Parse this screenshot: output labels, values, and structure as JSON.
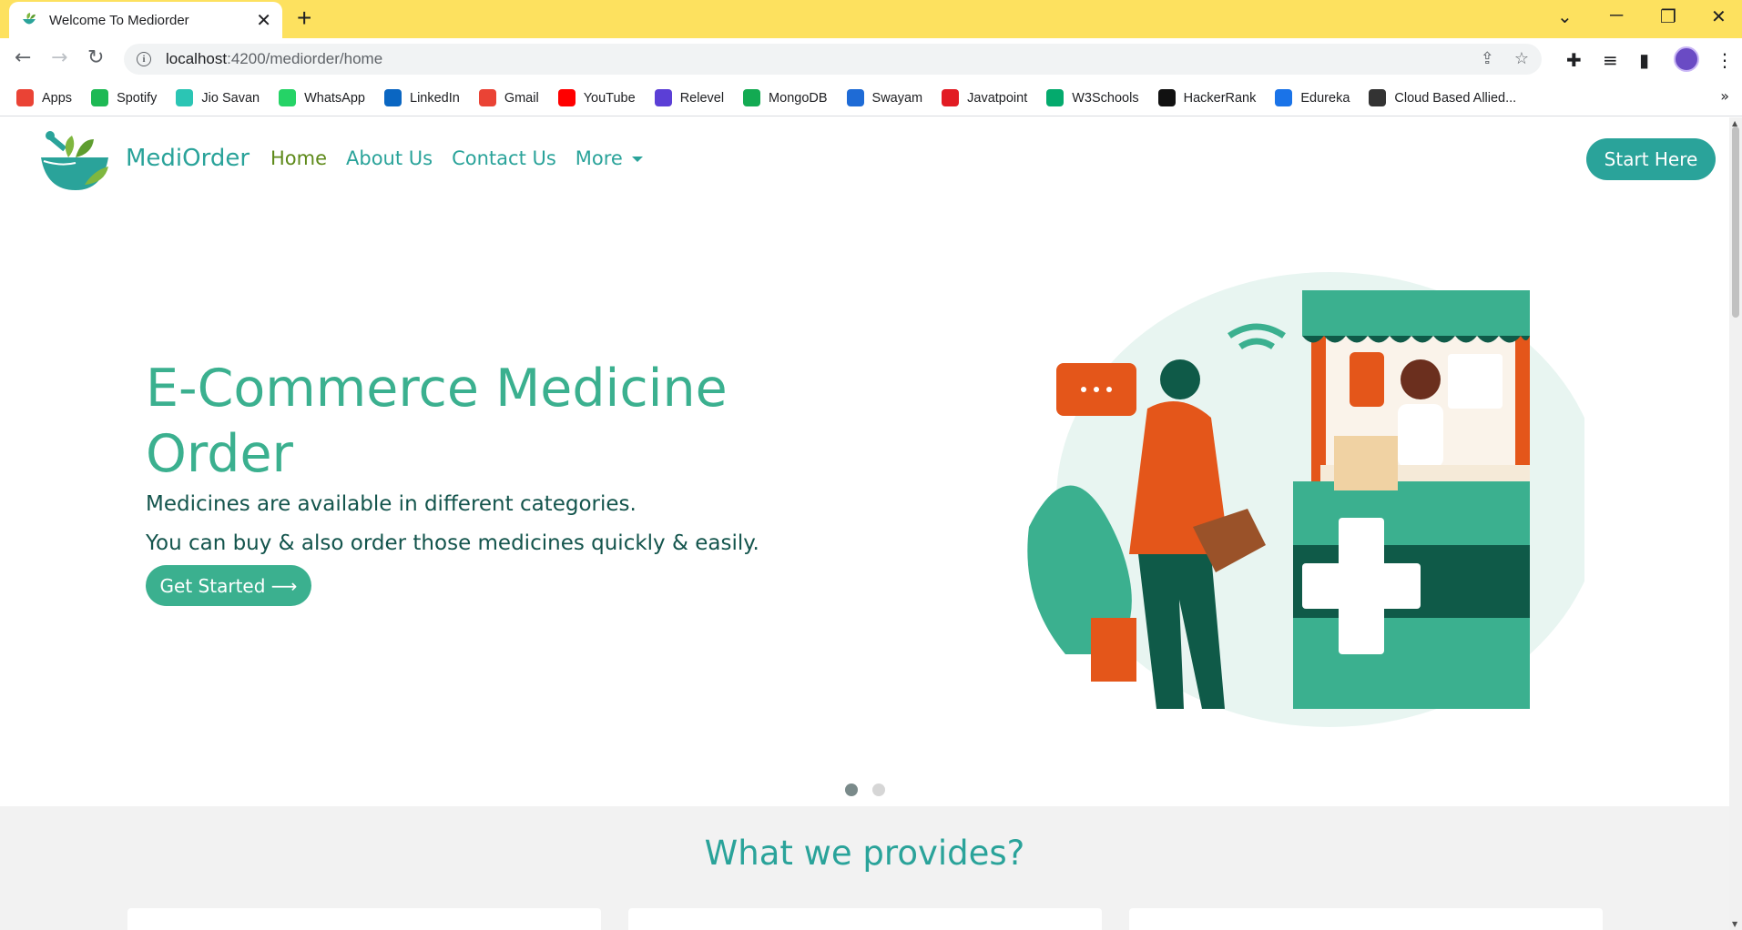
{
  "browser": {
    "tab_title": "Welcome To Mediorder",
    "url_host": "localhost",
    "url_path": ":4200/mediorder/home",
    "bookmarks": [
      {
        "label": "Apps",
        "icon": "apps-grid-icon",
        "color": "#ea4335"
      },
      {
        "label": "Spotify",
        "icon": "spotify-icon",
        "color": "#1db954"
      },
      {
        "label": "Jio Savan",
        "icon": "jiosaavn-icon",
        "color": "#2bc5b4"
      },
      {
        "label": "WhatsApp",
        "icon": "whatsapp-icon",
        "color": "#25d366"
      },
      {
        "label": "LinkedIn",
        "icon": "linkedin-icon",
        "color": "#0a66c2"
      },
      {
        "label": "Gmail",
        "icon": "gmail-icon",
        "color": "#ea4335"
      },
      {
        "label": "YouTube",
        "icon": "youtube-icon",
        "color": "#ff0000"
      },
      {
        "label": "Relevel",
        "icon": "relevel-icon",
        "color": "#5b3fd6"
      },
      {
        "label": "MongoDB",
        "icon": "mongodb-icon",
        "color": "#13aa52"
      },
      {
        "label": "Swayam",
        "icon": "swayam-icon",
        "color": "#1e6bd6"
      },
      {
        "label": "Javatpoint",
        "icon": "javatpoint-icon",
        "color": "#e21b23"
      },
      {
        "label": "W3Schools",
        "icon": "w3schools-icon",
        "color": "#04aa6d"
      },
      {
        "label": "HackerRank",
        "icon": "hackerrank-icon",
        "color": "#111111"
      },
      {
        "label": "Edureka",
        "icon": "edureka-icon",
        "color": "#1a73e8"
      },
      {
        "label": "Cloud Based Allied...",
        "icon": "globe-icon",
        "color": "#333333"
      }
    ]
  },
  "navbar": {
    "brand": "MediOrder",
    "links": [
      {
        "label": "Home",
        "active": true
      },
      {
        "label": "About Us",
        "active": false
      },
      {
        "label": "Contact Us",
        "active": false
      }
    ],
    "more_label": "More",
    "cta_label": "Start Here"
  },
  "hero": {
    "title": "E-Commerce Medicine Order",
    "line1": "Medicines are available in different categories.",
    "line2": "You can buy & also order those medicines quickly & easily.",
    "button_label": "Get Started ⟶",
    "carousel_active_index": 0,
    "carousel_count": 2
  },
  "section": {
    "title": "What we provides?"
  },
  "colors": {
    "accent": "#2aa39a",
    "hero_green": "#3bb08f",
    "dark_text": "#13544c",
    "chrome_yellow": "#fde15f"
  }
}
